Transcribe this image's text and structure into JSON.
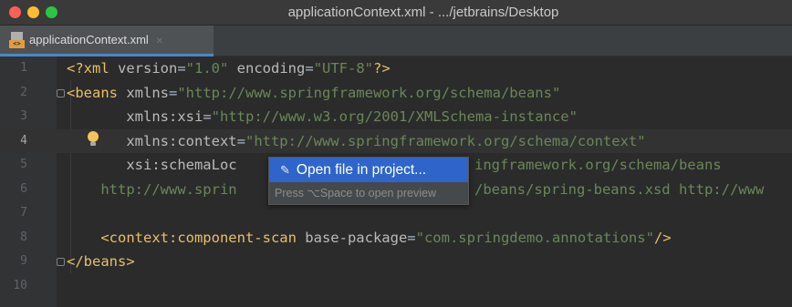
{
  "window": {
    "title": "applicationContext.xml - .../jetbrains/Desktop"
  },
  "tabs": [
    {
      "label": "applicationContext.xml",
      "icon": "xml-file-icon",
      "active": true
    }
  ],
  "editor": {
    "current_line": 4,
    "lines": [
      {
        "number": "1",
        "tokens": [
          "<?xml ",
          "version",
          "=",
          "\"1.0\"",
          " encoding",
          "=",
          "\"UTF-8\"",
          "?>"
        ]
      },
      {
        "number": "2",
        "tokens": [
          "<beans ",
          "xmlns",
          "=",
          "\"http://www.springframework.org/schema/beans\""
        ]
      },
      {
        "number": "3",
        "tokens": [
          "       xmlns:xsi",
          "=",
          "\"http://www.w3.org/2001/XMLSchema-instance\""
        ]
      },
      {
        "number": "4",
        "tokens": [
          "       xmlns:context",
          "=",
          "\"http://www.springframework.org/schema/context\""
        ]
      },
      {
        "number": "5",
        "tokens": [
          "       xsi:schemaLoc",
          "ingframework.org/schema/beans"
        ]
      },
      {
        "number": "6",
        "tokens": [
          "    http://www.sprin",
          "/beans/spring-beans.xsd http://www"
        ]
      },
      {
        "number": "7",
        "tokens": []
      },
      {
        "number": "8",
        "tokens": [
          "    <context:component-scan ",
          "base-package",
          "=",
          "\"com.springdemo.annotations\"",
          "/>"
        ]
      },
      {
        "number": "9",
        "tokens": [
          "</beans>"
        ]
      },
      {
        "number": "10",
        "tokens": []
      }
    ]
  },
  "popup": {
    "item_label": "Open file in project...",
    "item_icon": "open-in-project-icon",
    "hint": "Press ⌥Space to open preview"
  },
  "colors": {
    "background": "#2b2b2b",
    "tag": "#e8bf6a",
    "attribute": "#bababa",
    "string": "#6a8759",
    "selection": "#2f65ca"
  }
}
